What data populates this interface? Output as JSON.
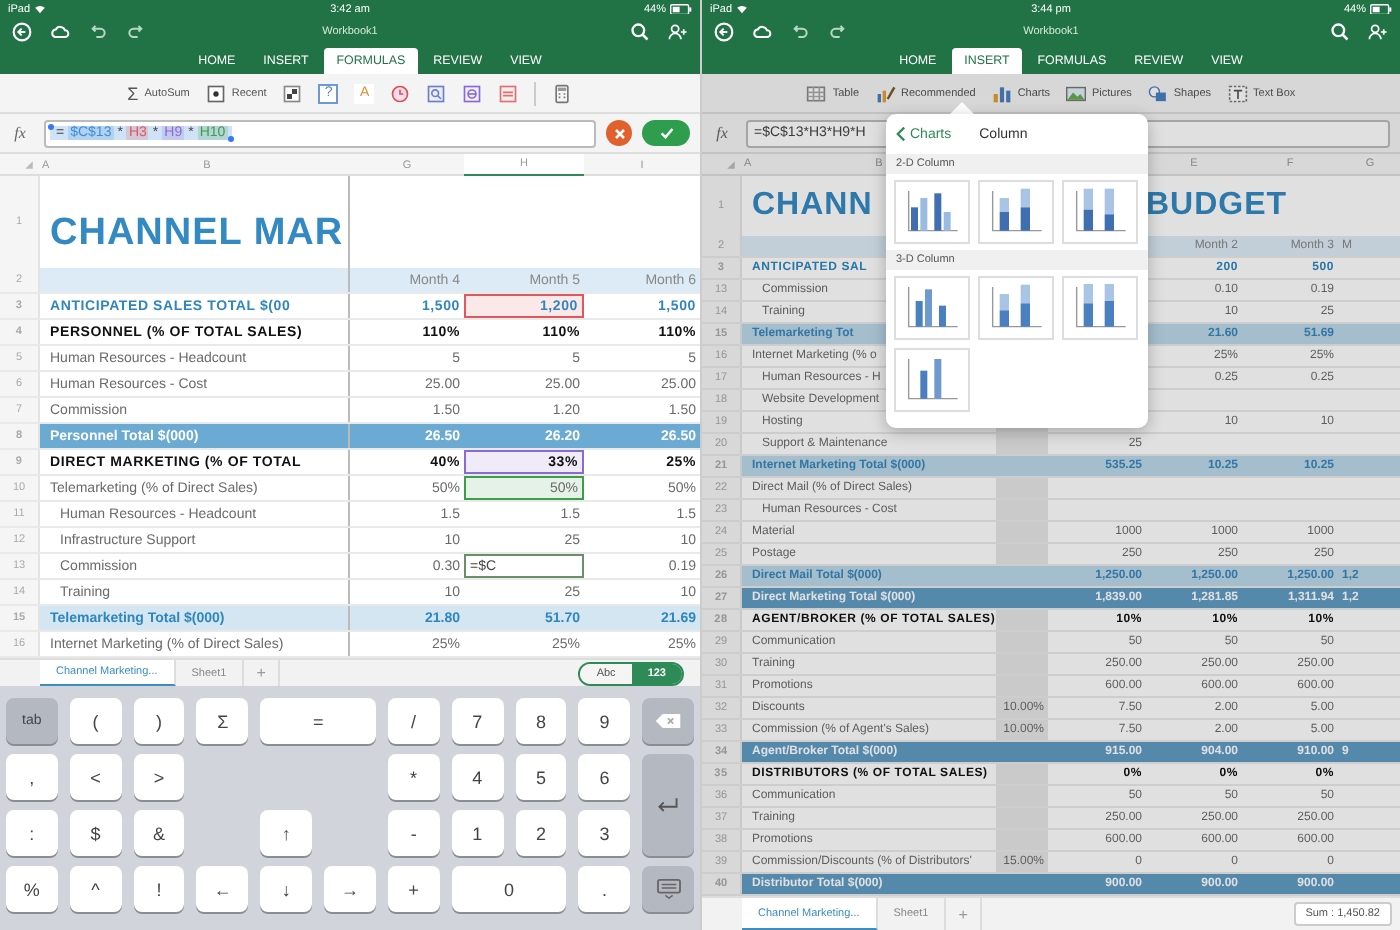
{
  "left_screen": {
    "status_bar": {
      "carrier": "iPad",
      "time": "3:42 am",
      "battery": "44%"
    },
    "title": "Workbook1",
    "tabs": [
      {
        "label": "HOME",
        "selected": false
      },
      {
        "label": "INSERT",
        "selected": false
      },
      {
        "label": "FORMULAS",
        "selected": true
      },
      {
        "label": "REVIEW",
        "selected": false
      },
      {
        "label": "VIEW",
        "selected": false
      }
    ],
    "ribbon": [
      {
        "kind": "autosum",
        "glyph": "Σ",
        "label": "AutoSum"
      },
      {
        "kind": "recent",
        "label": "Recent"
      },
      {
        "kind": "financial"
      },
      {
        "kind": "logical",
        "glyph": "?"
      },
      {
        "kind": "text",
        "glyph": "A"
      },
      {
        "kind": "date"
      },
      {
        "kind": "lookup"
      },
      {
        "kind": "math"
      },
      {
        "kind": "more"
      },
      {
        "kind": "calculator"
      }
    ],
    "formula_bar": {
      "label": "fx",
      "selected": true,
      "editing": true,
      "tokens": [
        {
          "text": "="
        },
        {
          "text": "$C$13",
          "color": "#3d8fd6"
        },
        {
          "text": "*"
        },
        {
          "text": "H3",
          "color": "#e0585d"
        },
        {
          "text": "*"
        },
        {
          "text": "H9",
          "color": "#8a6bd1"
        },
        {
          "text": "*"
        },
        {
          "text": "H10",
          "color": "#3f9d4a"
        }
      ]
    },
    "columns": [
      {
        "label": "A",
        "selected": false
      },
      {
        "label": "B",
        "selected": false
      },
      {
        "label": "G",
        "selected": false
      },
      {
        "label": "H",
        "selected": true
      },
      {
        "label": "I",
        "selected": false
      }
    ],
    "rows": [
      {
        "number": "1",
        "kind": "title",
        "label": "CHANNEL MAR",
        "cells": [
          null,
          null,
          null
        ]
      },
      {
        "number": "2",
        "kind": "header",
        "label": null,
        "cells": [
          "Month 4",
          "Month 5",
          "Month 6"
        ]
      },
      {
        "number": "3",
        "kind": "sales",
        "label": "ANTICIPATED SALES TOTAL $(00",
        "cells": [
          "1,500",
          {
            "text": "1,200",
            "color": "#e0585d"
          },
          "1,500"
        ]
      },
      {
        "number": "4",
        "kind": "heading",
        "label": "PERSONNEL (% OF TOTAL SALES)",
        "cells": [
          "110%",
          "110%",
          "110%"
        ]
      },
      {
        "number": "5",
        "kind": "item",
        "label": "Human Resources - Headcount",
        "cells": [
          "5",
          "5",
          "5"
        ]
      },
      {
        "number": "6",
        "kind": "item",
        "label": "Human Resources - Cost",
        "cells": [
          "25.00",
          "25.00",
          "25.00"
        ]
      },
      {
        "number": "7",
        "kind": "item",
        "label": "Commission",
        "cells": [
          "1.50",
          "1.20",
          "1.50"
        ]
      },
      {
        "number": "8",
        "kind": "total",
        "label": "Personnel Total $(000)",
        "cells": [
          "26.50",
          "26.20",
          "26.50"
        ]
      },
      {
        "number": "9",
        "kind": "heading",
        "label": "DIRECT MARKETING (% OF TOTAL",
        "cells": [
          "40%",
          {
            "text": "33%",
            "color": "#8a6bd1"
          },
          "25%"
        ]
      },
      {
        "number": "10",
        "kind": "item",
        "label": "Telemarketing (% of Direct Sales)",
        "cells": [
          "50%",
          {
            "text": "50%",
            "color": "#3f9d4a"
          },
          "50%"
        ]
      },
      {
        "number": "11",
        "kind": "subitem",
        "label": "Human Resources - Headcount",
        "cells": [
          "1.5",
          "1.5",
          "1.5"
        ]
      },
      {
        "number": "12",
        "kind": "subitem",
        "label": "Infrastructure Support",
        "cells": [
          "10",
          "25",
          "10"
        ]
      },
      {
        "number": "13",
        "kind": "subitem",
        "label": "Commission",
        "cells": [
          "0.30",
          {
            "text": "=$C",
            "editing": true
          },
          "0.19"
        ]
      },
      {
        "number": "14",
        "kind": "subitem",
        "label": "Training",
        "cells": [
          "10",
          "25",
          "10"
        ]
      },
      {
        "number": "15",
        "kind": "subtotal",
        "label": "Telemarketing Total $(000)",
        "cells": [
          "21.80",
          "51.70",
          "21.69"
        ]
      },
      {
        "number": "16",
        "kind": "item",
        "label": "Internet Marketing (% of Direct Sales)",
        "cells": [
          "25%",
          "25%",
          "25%"
        ]
      }
    ],
    "sheet_tabs": [
      {
        "label": "Channel Marketing...",
        "selected": true
      },
      {
        "label": "Sheet1",
        "selected": false
      }
    ],
    "add_sheet": "+",
    "input_modes": [
      {
        "label": "Abc",
        "selected": false
      },
      {
        "label": "123",
        "selected": true
      }
    ],
    "keyboard": [
      {
        "kind": "function",
        "label": "tab"
      },
      {
        "kind": "char",
        "label": "("
      },
      {
        "kind": "char",
        "label": ")"
      },
      {
        "kind": "char",
        "label": "Σ"
      },
      {
        "kind": "char",
        "label": "="
      },
      {
        "kind": "char",
        "label": "/"
      },
      {
        "kind": "char",
        "label": "7"
      },
      {
        "kind": "char",
        "label": "8"
      },
      {
        "kind": "char",
        "label": "9"
      },
      {
        "kind": "delete"
      },
      {
        "kind": "char",
        "label": ","
      },
      {
        "kind": "char",
        "label": "<"
      },
      {
        "kind": "char",
        "label": ">"
      },
      {
        "kind": "char",
        "label": "*"
      },
      {
        "kind": "char",
        "label": "4"
      },
      {
        "kind": "char",
        "label": "5"
      },
      {
        "kind": "char",
        "label": "6"
      },
      {
        "kind": "return"
      },
      {
        "kind": "char",
        "label": ":"
      },
      {
        "kind": "char",
        "label": "$"
      },
      {
        "kind": "char",
        "label": "&"
      },
      {
        "kind": "char",
        "label": "↑"
      },
      {
        "kind": "char",
        "label": "-"
      },
      {
        "kind": "char",
        "label": "1"
      },
      {
        "kind": "char",
        "label": "2"
      },
      {
        "kind": "char",
        "label": "3"
      },
      {
        "kind": "char",
        "label": "%"
      },
      {
        "kind": "char",
        "label": "^"
      },
      {
        "kind": "char",
        "label": "!"
      },
      {
        "kind": "char",
        "label": "←"
      },
      {
        "kind": "char",
        "label": "↓"
      },
      {
        "kind": "char",
        "label": "→"
      },
      {
        "kind": "char",
        "label": "+"
      },
      {
        "kind": "char",
        "label": "0"
      },
      {
        "kind": "char",
        "label": "."
      },
      {
        "kind": "hide"
      }
    ]
  },
  "right_screen": {
    "status_bar": {
      "carrier": "iPad",
      "time": "3:44 pm",
      "battery": "44%"
    },
    "title": "Workbook1",
    "tabs": [
      {
        "label": "HOME",
        "selected": false
      },
      {
        "label": "INSERT",
        "selected": true
      },
      {
        "label": "FORMULAS",
        "selected": false
      },
      {
        "label": "REVIEW",
        "selected": false
      },
      {
        "label": "VIEW",
        "selected": false
      }
    ],
    "ribbon": [
      {
        "kind": "table",
        "label": "Table"
      },
      {
        "kind": "recommended",
        "label": "Recommended"
      },
      {
        "kind": "charts",
        "label": "Charts"
      },
      {
        "kind": "pictures",
        "label": "Pictures"
      },
      {
        "kind": "shapes",
        "label": "Shapes"
      },
      {
        "kind": "textbox",
        "label": "Text Box"
      }
    ],
    "formula_bar": {
      "label": "fx",
      "selected": false,
      "editing": false,
      "tokens": [
        {
          "text": "=$C$13*H3*H9*H"
        }
      ]
    },
    "columns": [
      {
        "label": "A",
        "selected": false
      },
      {
        "label": "B",
        "selected": false
      },
      null,
      null,
      {
        "label": "E",
        "selected": false
      },
      {
        "label": "F",
        "selected": false
      },
      {
        "label": "G",
        "selected": false
      }
    ],
    "rows": [
      {
        "number": "1",
        "kind": "title",
        "label": "CHANN",
        "cells": [
          null,
          null,
          "BUDGET",
          null,
          null
        ]
      },
      {
        "number": "2",
        "kind": "header",
        "label": null,
        "cells": [
          null,
          null,
          "Month 2",
          "Month 3",
          "M"
        ]
      },
      {
        "number": "3",
        "kind": "sales",
        "label": "ANTICIPATED SAL",
        "cells": [
          null,
          null,
          "200",
          "500",
          null
        ]
      },
      {
        "number": "13",
        "kind": "subitem",
        "label": "Commission",
        "cells": [
          null,
          null,
          "0.10",
          "0.19",
          null
        ]
      },
      {
        "number": "14",
        "kind": "subitem",
        "label": "Training",
        "cells": [
          null,
          null,
          "10",
          "25",
          null
        ]
      },
      {
        "number": "15",
        "kind": "subtotal",
        "label": "Telemarketing Tot",
        "cells": [
          null,
          null,
          "21.60",
          "51.69",
          null
        ]
      },
      {
        "number": "16",
        "kind": "item",
        "label": "Internet Marketing (% o",
        "cells": [
          null,
          null,
          "25%",
          "25%",
          null
        ]
      },
      {
        "number": "17",
        "kind": "subitem",
        "label": "Human Resources - H",
        "cells": [
          null,
          null,
          "0.25",
          "0.25",
          null
        ]
      },
      {
        "number": "18",
        "kind": "subitem",
        "label": "Website Development",
        "cells": [
          null,
          null,
          null,
          null,
          null
        ]
      },
      {
        "number": "19",
        "kind": "subitem",
        "label": "Hosting",
        "cells": [
          null,
          null,
          "10",
          "10",
          null
        ]
      },
      {
        "number": "20",
        "kind": "subitem",
        "label": "Support & Maintenance",
        "cells": [
          null,
          "25",
          null,
          null,
          null
        ]
      },
      {
        "number": "21",
        "kind": "subtotal",
        "label": "Internet Marketing Total $(000)",
        "cells": [
          null,
          "535.25",
          "10.25",
          "10.25",
          null
        ]
      },
      {
        "number": "22",
        "kind": "item",
        "label": "Direct Mail (% of Direct Sales)",
        "cells": [
          null,
          null,
          null,
          null,
          null
        ]
      },
      {
        "number": "23",
        "kind": "subitem",
        "label": "Human Resources - Cost",
        "cells": [
          null,
          null,
          null,
          null,
          null
        ]
      },
      {
        "number": "24",
        "kind": "item",
        "label": "Material",
        "cells": [
          null,
          "1000",
          "1000",
          "1000",
          null
        ]
      },
      {
        "number": "25",
        "kind": "item",
        "label": "Postage",
        "cells": [
          null,
          "250",
          "250",
          "250",
          null
        ]
      },
      {
        "number": "26",
        "kind": "subtotal",
        "label": "Direct Mail Total $(000)",
        "cells": [
          null,
          "1,250.00",
          "1,250.00",
          "1,250.00",
          "1,2"
        ]
      },
      {
        "number": "27",
        "kind": "total",
        "label": "Direct Marketing Total $(000)",
        "cells": [
          null,
          "1,839.00",
          "1,281.85",
          "1,311.94",
          "1,2"
        ]
      },
      {
        "number": "28",
        "kind": "heading",
        "label": "AGENT/BROKER (% OF TOTAL SALES)",
        "cells": [
          null,
          "10%",
          "10%",
          "10%",
          null
        ]
      },
      {
        "number": "29",
        "kind": "item",
        "label": "Communication",
        "cells": [
          null,
          "50",
          "50",
          "50",
          null
        ]
      },
      {
        "number": "30",
        "kind": "item",
        "label": "Training",
        "cells": [
          null,
          "250.00",
          "250.00",
          "250.00",
          null
        ]
      },
      {
        "number": "31",
        "kind": "item",
        "label": "Promotions",
        "cells": [
          null,
          "600.00",
          "600.00",
          "600.00",
          null
        ]
      },
      {
        "number": "32",
        "kind": "item",
        "label": "Discounts",
        "cells": [
          "10.00%",
          "7.50",
          "2.00",
          "5.00",
          null
        ]
      },
      {
        "number": "33",
        "kind": "item",
        "label": "Commission (% of Agent's Sales)",
        "cells": [
          "10.00%",
          "7.50",
          "2.00",
          "5.00",
          null
        ]
      },
      {
        "number": "34",
        "kind": "total",
        "label": "Agent/Broker Total $(000)",
        "cells": [
          null,
          "915.00",
          "904.00",
          "910.00",
          "9"
        ]
      },
      {
        "number": "35",
        "kind": "heading",
        "label": "DISTRIBUTORS (% OF TOTAL SALES)",
        "cells": [
          null,
          "0%",
          "0%",
          "0%",
          null
        ]
      },
      {
        "number": "36",
        "kind": "item",
        "label": "Communication",
        "cells": [
          null,
          "50",
          "50",
          "50",
          null
        ]
      },
      {
        "number": "37",
        "kind": "item",
        "label": "Training",
        "cells": [
          null,
          "250.00",
          "250.00",
          "250.00",
          null
        ]
      },
      {
        "number": "38",
        "kind": "item",
        "label": "Promotions",
        "cells": [
          null,
          "600.00",
          "600.00",
          "600.00",
          null
        ]
      },
      {
        "number": "39",
        "kind": "item",
        "label": "Commission/Discounts (% of Distributors'",
        "cells": [
          "15.00%",
          "0",
          "0",
          "0",
          null
        ]
      },
      {
        "number": "40",
        "kind": "total",
        "label": "Distributor Total $(000)",
        "cells": [
          null,
          "900.00",
          "900.00",
          "900.00",
          null
        ]
      }
    ],
    "sheet_tabs": [
      {
        "label": "Channel Marketing...",
        "selected": true
      },
      {
        "label": "Sheet1",
        "selected": false
      }
    ],
    "add_sheet": "+",
    "sum": "Sum : 1,450.82",
    "popover": {
      "back": "Charts",
      "title": "Column",
      "sections": [
        {
          "title": "2-D Column",
          "items": [
            {
              "kind": "clustered"
            },
            {
              "kind": "stacked"
            },
            {
              "kind": "stacked-100"
            }
          ]
        },
        {
          "title": "3-D Column",
          "items": [
            {
              "kind": "clustered-3d"
            },
            {
              "kind": "stacked-3d"
            },
            {
              "kind": "stacked-100-3d"
            },
            {
              "kind": "column-3d"
            }
          ]
        }
      ]
    }
  }
}
